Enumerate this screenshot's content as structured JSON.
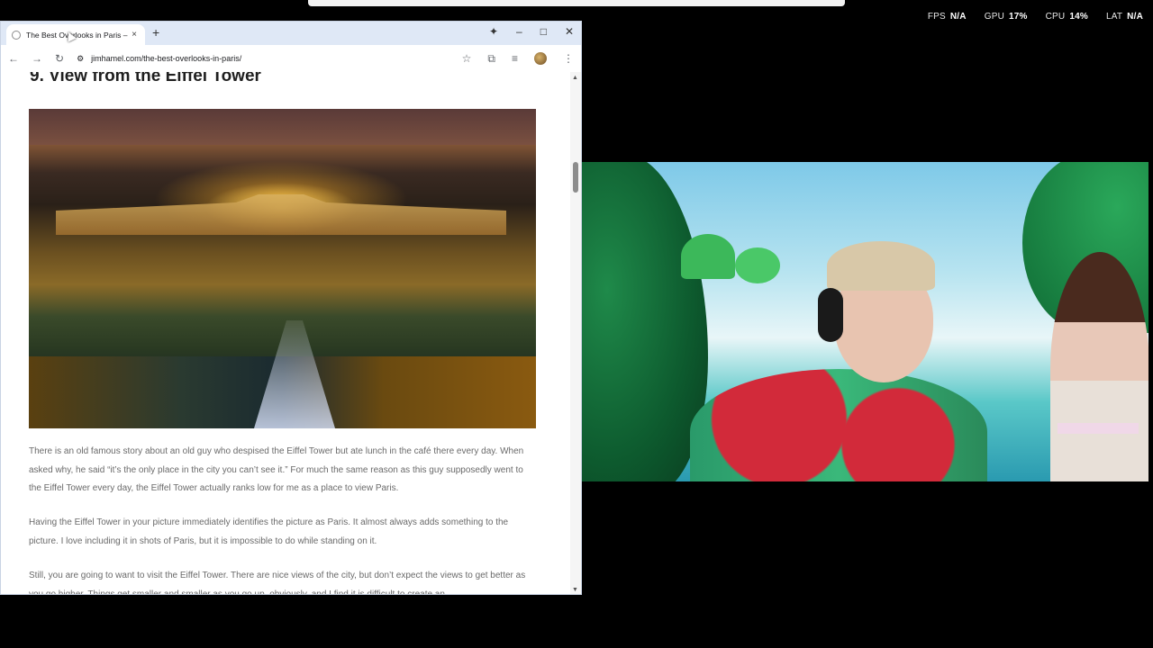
{
  "perf": {
    "fps_label": "FPS",
    "fps_value": "N/A",
    "gpu_label": "GPU",
    "gpu_value": "17%",
    "cpu_label": "CPU",
    "cpu_value": "14%",
    "lat_label": "LAT",
    "lat_value": "N/A"
  },
  "browser": {
    "tab_title": "The Best Overlooks in Paris – Ji",
    "url": "jimhamel.com/the-best-overlooks-in-paris/",
    "icons": {
      "favicon": "site-favicon-icon",
      "close": "×",
      "newtab": "+",
      "gemini": "✦",
      "minimize": "–",
      "maximize": "□",
      "window_close": "✕",
      "back": "←",
      "forward": "→",
      "reload": "↻",
      "site_info": "⚙",
      "star": "☆",
      "lens": "⧉",
      "reading_list": "≡",
      "menu": "⋮"
    }
  },
  "article": {
    "heading": "9. View from the Eiffel Tower",
    "p1": "There is an old famous story about an old guy who despised the Eiffel Tower but ate lunch in the café there every day. When asked why, he said “it’s the only place in the city you can’t see it.”  For much the same reason as this guy supposedly went to the Eiffel Tower every day, the Eiffel Tower actually ranks low for me as a place to view Paris.",
    "p2": "Having the Eiffel Tower in your picture immediately identifies the picture as Paris.  It almost always adds something to the picture.  I love including it in shots of Paris, but it is impossible to do while standing on it.",
    "p3": "Still, you are going to want to visit the Eiffel Tower.  There are nice views of the city, but don’t expect the views to get better as you go higher.  Things get smaller and smaller as you go up, obviously, and I find it is difficult to create an"
  },
  "scrollbar": {
    "up": "▲",
    "down": "▼"
  }
}
